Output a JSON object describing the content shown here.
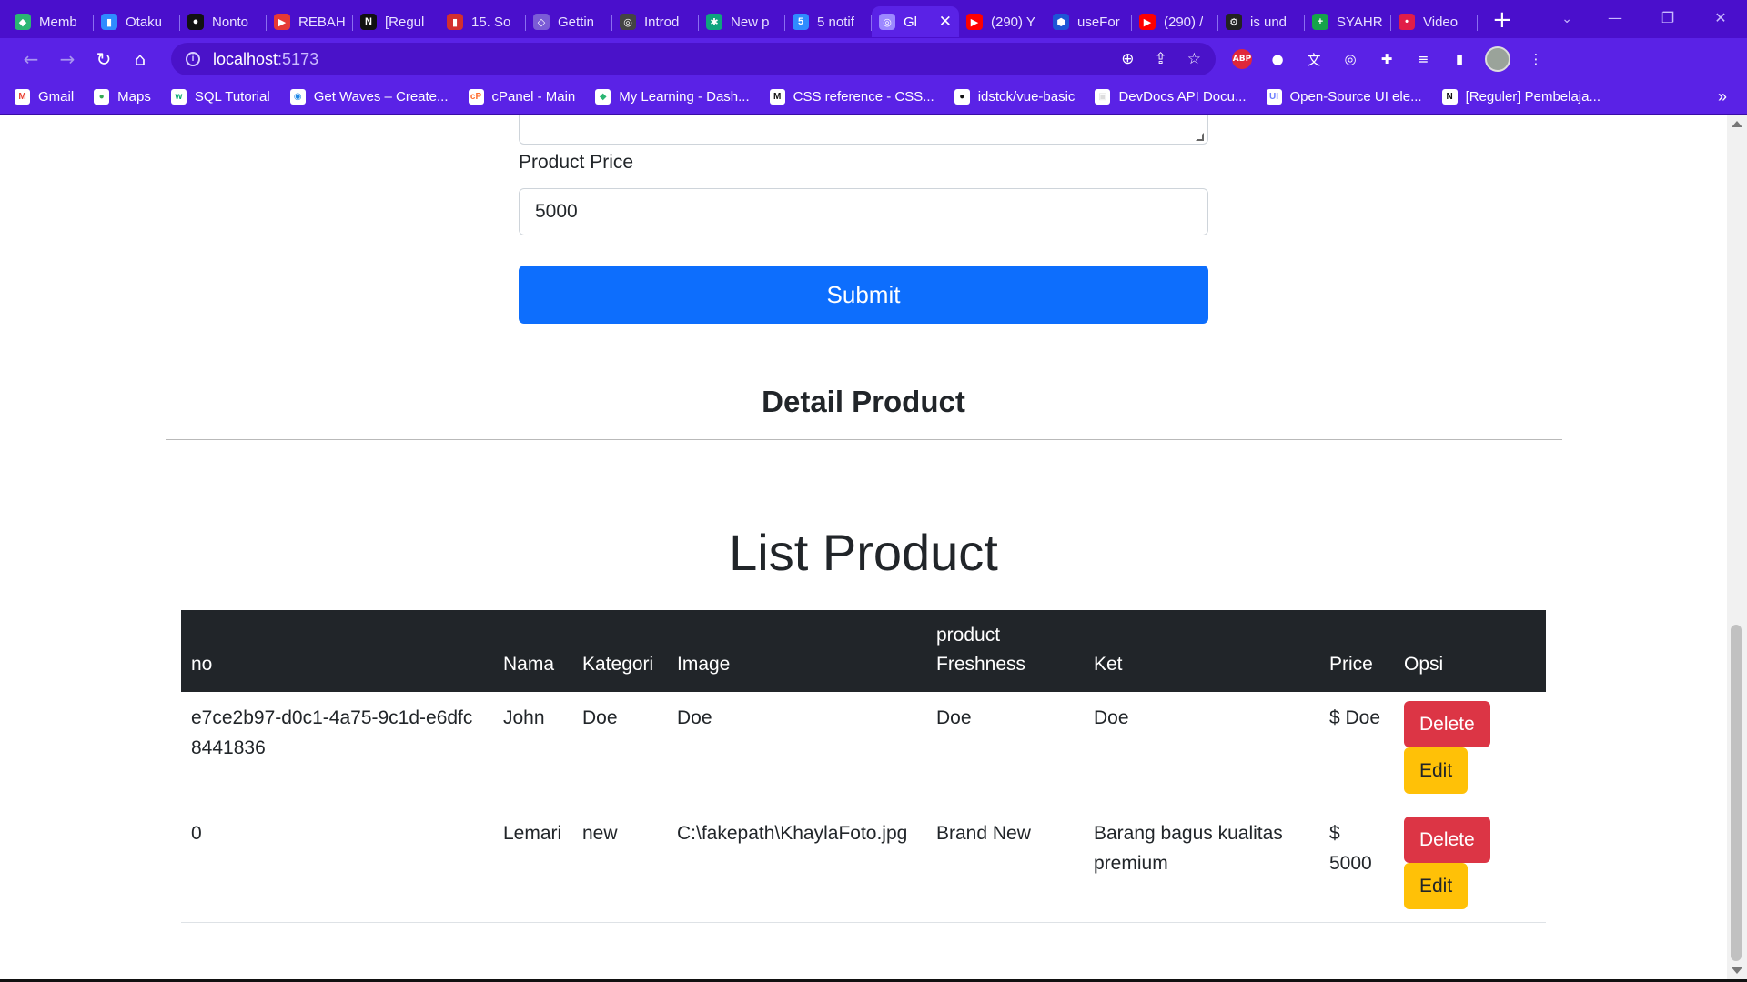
{
  "browser": {
    "tabs": [
      {
        "label": "Memb",
        "favicon_color": "#2bb673",
        "favicon_char": "◆"
      },
      {
        "label": "Otaku",
        "favicon_color": "#2f8cff",
        "favicon_char": "▮"
      },
      {
        "label": "Nonto",
        "favicon_color": "#111111",
        "favicon_char": "●"
      },
      {
        "label": "REBAH",
        "favicon_color": "#e53935",
        "favicon_char": "▶"
      },
      {
        "label": "[Regul",
        "favicon_color": "#111111",
        "favicon_char": "N"
      },
      {
        "label": "15. So",
        "favicon_color": "#d32f2f",
        "favicon_char": "▮"
      },
      {
        "label": "Gettin",
        "favicon_color": "#7b5cd6",
        "favicon_char": "◇"
      },
      {
        "label": "Introd",
        "favicon_color": "#444444",
        "favicon_char": "◎"
      },
      {
        "label": "New p",
        "favicon_color": "#10a37f",
        "favicon_char": "✱"
      },
      {
        "label": "5 notif",
        "favicon_color": "#2f8cff",
        "favicon_char": "5"
      },
      {
        "label": "Gl",
        "favicon_color": "#9c88ff",
        "favicon_char": "◎",
        "active": true
      },
      {
        "label": "(290) Y",
        "favicon_color": "#ff0000",
        "favicon_char": "▶"
      },
      {
        "label": "useFor",
        "favicon_color": "#1e55d6",
        "favicon_char": "⬢"
      },
      {
        "label": "(290) /",
        "favicon_color": "#ff0000",
        "favicon_char": "▶"
      },
      {
        "label": "is und",
        "favicon_color": "#222222",
        "favicon_char": "⚙"
      },
      {
        "label": "SYAHR",
        "favicon_color": "#16a34a",
        "favicon_char": "+"
      },
      {
        "label": "Video",
        "favicon_color": "#e11d48",
        "favicon_char": "•"
      }
    ],
    "url_host": "localhost",
    "url_port": ":5173",
    "bookmarks": [
      {
        "label": "Gmail",
        "icon_color": "#ea4335",
        "icon_char": "M"
      },
      {
        "label": "Maps",
        "icon_color": "#34a853",
        "icon_char": "●"
      },
      {
        "label": "SQL Tutorial",
        "icon_color": "#04aa6d",
        "icon_char": "w"
      },
      {
        "label": "Get Waves – Create...",
        "icon_color": "#1e88e5",
        "icon_char": "◉"
      },
      {
        "label": "cPanel - Main",
        "icon_color": "#ff6c2c",
        "icon_char": "cP"
      },
      {
        "label": "My Learning - Dash...",
        "icon_color": "#2bb673",
        "icon_char": "◆"
      },
      {
        "label": "CSS reference - CSS...",
        "icon_color": "#111111",
        "icon_char": "M"
      },
      {
        "label": "idstck/vue-basic",
        "icon_color": "#111111",
        "icon_char": "●"
      },
      {
        "label": "DevDocs API Docu...",
        "icon_color": "#dddddd",
        "icon_char": "▣"
      },
      {
        "label": "Open-Source UI ele...",
        "icon_color": "#6b7cff",
        "icon_char": "UI"
      },
      {
        "label": "[Reguler] Pembelaja...",
        "icon_color": "#111111",
        "icon_char": "N"
      }
    ],
    "bookmarks_more": "»"
  },
  "form": {
    "price_label": "Product Price",
    "price_value": "5000",
    "submit_label": "Submit"
  },
  "detail_title": "Detail Product",
  "list_title": "List Product",
  "table": {
    "headers": {
      "no": "no",
      "nama": "Nama",
      "kategori": "Kategori",
      "image": "Image",
      "freshness_line1": "product",
      "freshness_line2": "Freshness",
      "ket": "Ket",
      "price": "Price",
      "opsi": "Opsi"
    },
    "rows": [
      {
        "no": "e7ce2b97-d0c1-4a75-9c1d-e6dfc8441836",
        "nama": "John",
        "kategori": "Doe",
        "image": "Doe",
        "freshness": "Doe",
        "ket": "Doe",
        "price": "$ Doe",
        "delete_label": "Delete",
        "edit_label": "Edit"
      },
      {
        "no": "0",
        "nama": "Lemari",
        "kategori": "new",
        "image": "C:\\fakepath\\KhaylaFoto.jpg",
        "freshness": "Brand New",
        "ket": "Barang bagus kualitas premium",
        "price": "$ 5000",
        "delete_label": "Delete",
        "edit_label": "Edit"
      }
    ]
  },
  "colors": {
    "chrome_purple": "#5a22e6",
    "primary": "#0d6efd",
    "danger": "#dc3545",
    "warning": "#ffc107",
    "table_head": "#212529"
  }
}
